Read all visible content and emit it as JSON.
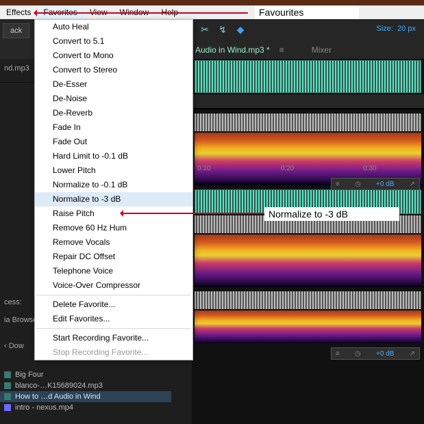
{
  "menubar": [
    "Effects",
    "Favorites",
    "View",
    "Window",
    "Help"
  ],
  "menubar_active": 1,
  "toolbar": {
    "br_btn": "ack",
    "size_label": "Size:",
    "size_value": "20 px"
  },
  "panelrow": {
    "filename": "Audio in Wind.mp3 *",
    "mixer": "Mixer",
    "menu_icon": "≡"
  },
  "leftcol": [
    "nd.mp3"
  ],
  "dropdown": {
    "groups": [
      [
        "Auto Heal",
        "Convert to 5.1",
        "Convert to Mono",
        "Convert to Stereo",
        "De-Esser",
        "De-Noise",
        "De-Reverb",
        "Fade In",
        "Fade Out",
        "Hard Limit to -0.1 dB",
        "Lower Pitch",
        "Normalize to -0.1 dB",
        "Normalize to -3 dB",
        "Raise Pitch",
        "Remove 60 Hz Hum",
        "Remove Vocals",
        "Repair DC Offset",
        "Telephone Voice",
        "Voice-Over Compressor"
      ],
      [
        "Delete Favorite...",
        "Edit Favorites..."
      ],
      [
        "Start Recording Favorite...",
        "Stop Recording Favorite..."
      ]
    ],
    "highlighted": "Normalize to -3 dB",
    "disabled": [
      "Stop Recording Favorite..."
    ]
  },
  "timeline": {
    "ticks": [
      "0:10",
      "0:20",
      "0:30"
    ]
  },
  "track_db": {
    "value": "+0 dB",
    "meter_icon": "≡",
    "clock_icon": "◷",
    "arrow_icon": "↗"
  },
  "left_labels": {
    "cess": "cess:",
    "browse": "ia Browse",
    "dow": "Dow"
  },
  "files": [
    {
      "name": "Big Four",
      "kind": "a"
    },
    {
      "name": "blanco-…K15689024.mp3",
      "kind": "a"
    },
    {
      "name": "How to …d Audio in Wind",
      "kind": "a",
      "selected": true
    },
    {
      "name": "intro - nexus.mp4",
      "kind": "v"
    }
  ],
  "callouts": {
    "fav": "Favourites",
    "norm": "Normalize to -3 dB"
  }
}
